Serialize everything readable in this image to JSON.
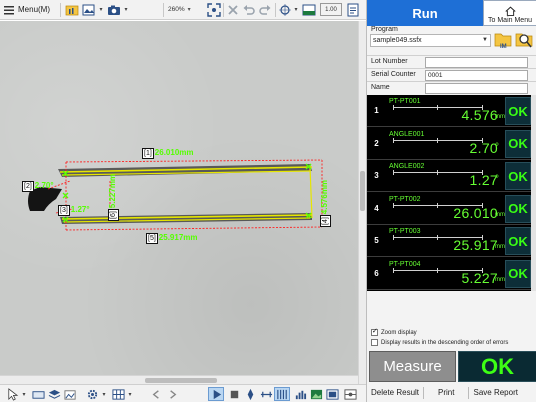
{
  "toolbar": {
    "menu_label": "Menu(M)",
    "zoom_value": "260%",
    "ratio_value": "1.00"
  },
  "canvas": {
    "labels": [
      {
        "index": "[1]",
        "value": "26.010mm"
      },
      {
        "index": "[2]",
        "value": "2.70°"
      },
      {
        "index": "[3]",
        "value": "1.27°"
      },
      {
        "index": "[4]",
        "value": "4.576mm"
      },
      {
        "index": "[5]",
        "value": "25.917mm"
      },
      {
        "index": "[6]",
        "value": "5.227mm"
      }
    ]
  },
  "panel": {
    "run_tab": "Run",
    "main_menu": "To Main Menu",
    "program_label": "Program",
    "program_value": "sample049.ssfx",
    "fields": [
      {
        "label": "Lot Number",
        "value": ""
      },
      {
        "label": "Serial Counter",
        "value": "0001"
      },
      {
        "label": "Name",
        "value": ""
      }
    ],
    "results": [
      {
        "num": "1",
        "name": "PT-PT001",
        "value": "4.576",
        "unit": "mm",
        "status": "OK"
      },
      {
        "num": "2",
        "name": "ANGLE001",
        "value": "2.70",
        "unit": "°",
        "status": "OK"
      },
      {
        "num": "3",
        "name": "ANGLE002",
        "value": "1.27",
        "unit": "°",
        "status": "OK"
      },
      {
        "num": "4",
        "name": "PT-PT002",
        "value": "26.010",
        "unit": "mm",
        "status": "OK"
      },
      {
        "num": "5",
        "name": "PT-PT003",
        "value": "25.917",
        "unit": "mm",
        "status": "OK"
      },
      {
        "num": "6",
        "name": "PT-PT004",
        "value": "5.227",
        "unit": "mm",
        "status": "OK"
      }
    ],
    "zoom_display": "Zoom display",
    "descending_errors": "Display results in the descending order of errors",
    "measure_button": "Measure",
    "overall_result": "OK",
    "delete_result": "Delete Result",
    "print": "Print",
    "save_report": "Save Report"
  },
  "colors": {
    "accent": "#1e6fd6",
    "result_green": "#66ff33",
    "ok_bg": "#0d2e38",
    "measure_line_red": "#ff2020"
  }
}
